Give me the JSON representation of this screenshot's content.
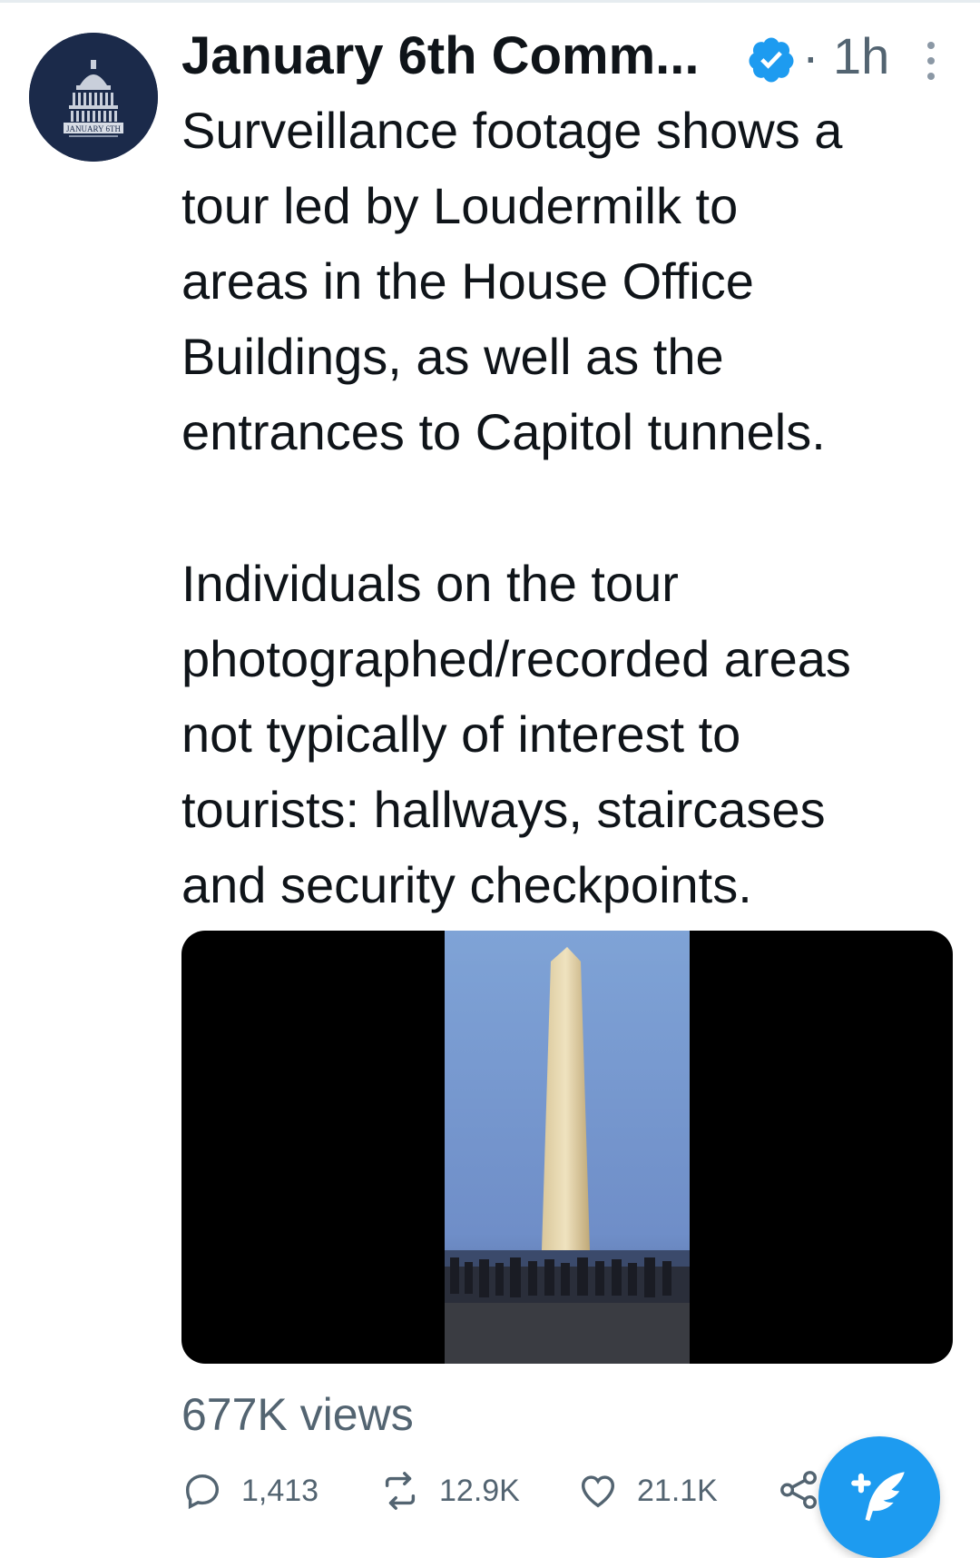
{
  "tweet": {
    "author_name": "January 6th Comm...",
    "separator": "·",
    "timestamp": "1h",
    "paragraphs": [
      "Surveillance footage shows a\ntour led by Loudermilk to\nareas in the House Office\nBuildings, as well as the\nentrances to Capitol tunnels.",
      "Individuals on the tour\nphotographed/recorded areas\nnot typically of interest to\ntourists: hallways, staircases\nand security checkpoints."
    ],
    "avatar_text": "JANUARY 6TH",
    "views": "677K views",
    "actions": {
      "replies": "1,413",
      "retweets": "12.9K",
      "likes": "21.1K"
    }
  },
  "icons": {
    "verified": "verified-badge-icon",
    "more": "more-vertical-icon",
    "reply": "reply-icon",
    "retweet": "retweet-icon",
    "like": "heart-icon",
    "share": "share-icon",
    "compose": "compose-tweet-icon"
  },
  "colors": {
    "accent": "#1d9bf0",
    "secondary_text": "#536471",
    "avatar_bg": "#1b2a4a"
  }
}
